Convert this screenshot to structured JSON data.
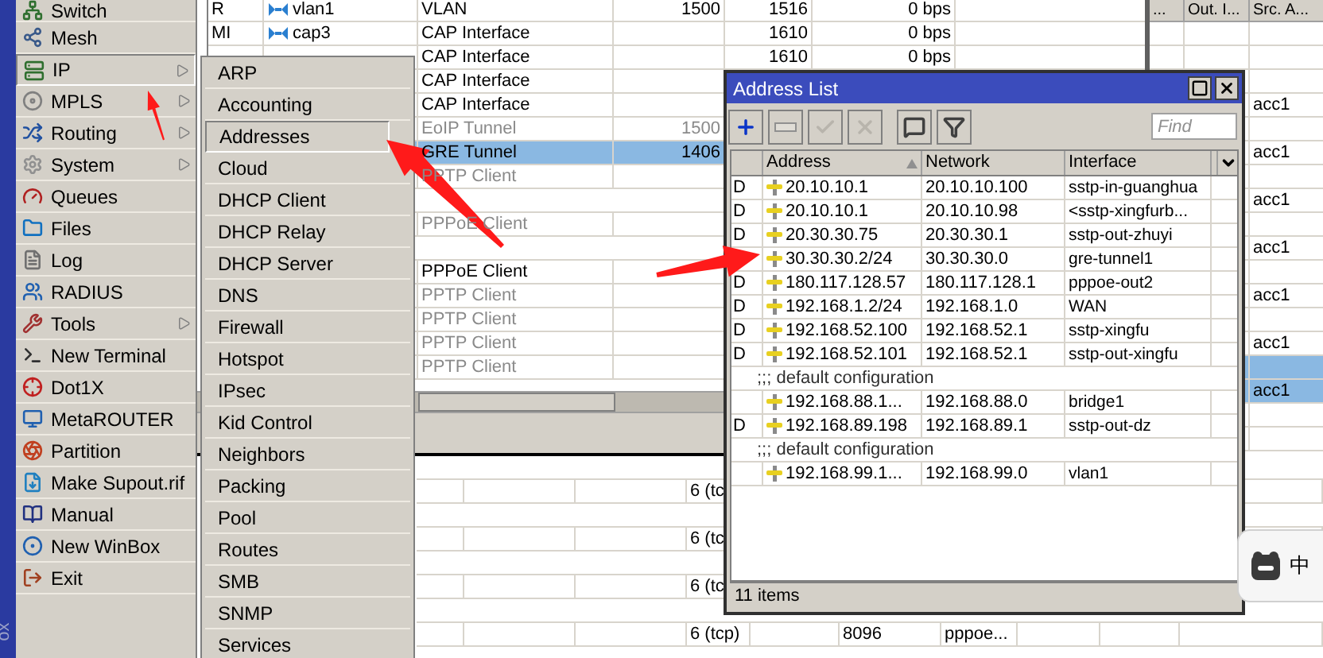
{
  "sidebar_label": "ox",
  "main_menu": [
    {
      "label": "Switch",
      "selected": false,
      "submenu": false
    },
    {
      "label": "Mesh",
      "selected": false,
      "submenu": false
    },
    {
      "label": "IP",
      "selected": true,
      "submenu": true
    },
    {
      "label": "MPLS",
      "selected": false,
      "submenu": true
    },
    {
      "label": "Routing",
      "selected": false,
      "submenu": true
    },
    {
      "label": "System",
      "selected": false,
      "submenu": true
    },
    {
      "label": "Queues",
      "selected": false,
      "submenu": false
    },
    {
      "label": "Files",
      "selected": false,
      "submenu": false
    },
    {
      "label": "Log",
      "selected": false,
      "submenu": false
    },
    {
      "label": "RADIUS",
      "selected": false,
      "submenu": false
    },
    {
      "label": "Tools",
      "selected": false,
      "submenu": true
    },
    {
      "label": "New Terminal",
      "selected": false,
      "submenu": false
    },
    {
      "label": "Dot1X",
      "selected": false,
      "submenu": false
    },
    {
      "label": "MetaROUTER",
      "selected": false,
      "submenu": false
    },
    {
      "label": "Partition",
      "selected": false,
      "submenu": false
    },
    {
      "label": "Make Supout.rif",
      "selected": false,
      "submenu": false
    },
    {
      "label": "Manual",
      "selected": false,
      "submenu": false
    },
    {
      "label": "New WinBox",
      "selected": false,
      "submenu": false
    },
    {
      "label": "Exit",
      "selected": false,
      "submenu": false
    }
  ],
  "ip_submenu": [
    {
      "label": "ARP",
      "selected": false
    },
    {
      "label": "Accounting",
      "selected": false
    },
    {
      "label": "Addresses",
      "selected": true
    },
    {
      "label": "Cloud",
      "selected": false
    },
    {
      "label": "DHCP Client",
      "selected": false
    },
    {
      "label": "DHCP Relay",
      "selected": false
    },
    {
      "label": "DHCP Server",
      "selected": false
    },
    {
      "label": "DNS",
      "selected": false
    },
    {
      "label": "Firewall",
      "selected": false
    },
    {
      "label": "Hotspot",
      "selected": false
    },
    {
      "label": "IPsec",
      "selected": false
    },
    {
      "label": "Kid Control",
      "selected": false
    },
    {
      "label": "Neighbors",
      "selected": false
    },
    {
      "label": "Packing",
      "selected": false
    },
    {
      "label": "Pool",
      "selected": false
    },
    {
      "label": "Routes",
      "selected": false
    },
    {
      "label": "SMB",
      "selected": false
    },
    {
      "label": "SNMP",
      "selected": false
    },
    {
      "label": "Services",
      "selected": false
    }
  ],
  "interface_table": {
    "rows": [
      {
        "kind": "interface",
        "flags": "R",
        "name": "vlan1",
        "type": "VLAN",
        "actual_mtu": "1500",
        "l2_mtu": "1516",
        "tx": "0 bps",
        "selected": false,
        "disabled": false
      },
      {
        "kind": "interface",
        "flags": "MI",
        "name": "cap3",
        "type": "CAP Interface",
        "l2_mtu": "1610",
        "tx": "0 bps",
        "selected": false,
        "disabled": false
      },
      {
        "kind": "interface",
        "type": "CAP Interface",
        "l2_mtu": "1610",
        "tx": "0 bps",
        "selected": false,
        "disabled": false
      },
      {
        "kind": "interface",
        "type": "CAP Interface",
        "selected": false,
        "disabled": false
      },
      {
        "kind": "interface",
        "type": "CAP Interface",
        "selected": false,
        "disabled": false
      },
      {
        "kind": "interface",
        "type": "EoIP Tunnel",
        "actual_mtu": "1500",
        "selected": false,
        "disabled": true
      },
      {
        "kind": "interface",
        "type": "GRE Tunnel",
        "actual_mtu": "1406",
        "selected": true,
        "disabled": false
      },
      {
        "kind": "interface",
        "type": "PPTP Client",
        "selected": false,
        "disabled": true
      },
      {
        "kind": "blank"
      },
      {
        "kind": "interface",
        "type": "PPPoE Client",
        "selected": false,
        "disabled": true
      },
      {
        "kind": "blank"
      },
      {
        "kind": "interface",
        "type": "PPPoE Client",
        "selected": false,
        "disabled": false
      },
      {
        "kind": "interface",
        "type": "PPTP Client",
        "selected": false,
        "disabled": true
      },
      {
        "kind": "interface",
        "type": "PPTP Client",
        "selected": false,
        "disabled": true
      },
      {
        "kind": "interface",
        "type": "PPTP Client",
        "selected": false,
        "disabled": true
      },
      {
        "kind": "interface",
        "type": "PPTP Client",
        "selected": false,
        "disabled": true
      }
    ]
  },
  "side_table": {
    "columns": [
      "...",
      "Out. I...",
      "Src. A..."
    ],
    "rows": [
      {
        "selected": false
      },
      {
        "selected": false
      },
      {
        "selected": false
      },
      {
        "src_address": "acc1",
        "selected": false
      },
      {
        "selected": false
      },
      {
        "src_address": "acc1",
        "selected": false
      },
      {
        "selected": false
      },
      {
        "src_address": "acc1",
        "selected": false
      },
      {
        "selected": false
      },
      {
        "src_address": "acc1",
        "selected": false
      },
      {
        "selected": false
      },
      {
        "src_address": "acc1",
        "selected": false
      },
      {
        "selected": false
      },
      {
        "src_address": "acc1",
        "selected": false
      },
      {
        "selected": true
      },
      {
        "src_address": "acc1",
        "selected": true
      },
      {
        "selected": false
      },
      {
        "selected": false
      }
    ]
  },
  "lower_table": {
    "rows": [
      {
        "kind": "comment"
      },
      {
        "kind": "data",
        "protocol": "6 (tc"
      },
      {
        "kind": "comment"
      },
      {
        "kind": "data",
        "protocol": "6 (tc"
      },
      {
        "kind": "comment"
      },
      {
        "kind": "data",
        "protocol": "6 (tc"
      },
      {
        "kind": "comment"
      },
      {
        "kind": "data",
        "protocol": "6 (tcp)",
        "port": "8096",
        "interface": "pppoe..."
      },
      {
        "kind": "comment"
      }
    ]
  },
  "address_list": {
    "title": "Address List",
    "toolbar": [
      {
        "kind": "add",
        "disabled": false
      },
      {
        "kind": "remove",
        "disabled": false
      },
      {
        "kind": "enable",
        "disabled": true
      },
      {
        "kind": "disable",
        "disabled": true
      },
      {
        "kind": "comment",
        "disabled": false
      },
      {
        "kind": "filter",
        "disabled": false
      }
    ],
    "search": {
      "placeholder": "Find"
    },
    "columns": [
      {
        "label": "Address",
        "sorted": true
      },
      {
        "label": "Network",
        "sorted": false
      },
      {
        "label": "Interface",
        "sorted": false
      }
    ],
    "rows": [
      {
        "kind": "address",
        "flag": "D",
        "address": "20.10.10.1",
        "network": "20.10.10.100",
        "interface": "sstp-in-guanghua"
      },
      {
        "kind": "address",
        "flag": "D",
        "address": "20.10.10.1",
        "network": "20.10.10.98",
        "interface": "<sstp-xingfurb..."
      },
      {
        "kind": "address",
        "flag": "D",
        "address": "20.30.30.75",
        "network": "20.30.30.1",
        "interface": "sstp-out-zhuyi"
      },
      {
        "kind": "address",
        "address": "30.30.30.2/24",
        "network": "30.30.30.0",
        "interface": "gre-tunnel1"
      },
      {
        "kind": "address",
        "flag": "D",
        "address": "180.117.128.57",
        "network": "180.117.128.1",
        "interface": "pppoe-out2"
      },
      {
        "kind": "address",
        "flag": "D",
        "address": "192.168.1.2/24",
        "network": "192.168.1.0",
        "interface": "WAN"
      },
      {
        "kind": "address",
        "flag": "D",
        "address": "192.168.52.100",
        "network": "192.168.52.1",
        "interface": "sstp-xingfu"
      },
      {
        "kind": "address",
        "flag": "D",
        "address": "192.168.52.101",
        "network": "192.168.52.1",
        "interface": "sstp-out-xingfu"
      },
      {
        "kind": "comment",
        "text": ";;; default configuration"
      },
      {
        "kind": "address",
        "address": "192.168.88.1...",
        "network": "192.168.88.0",
        "interface": "bridge1"
      },
      {
        "kind": "address",
        "flag": "D",
        "address": "192.168.89.198",
        "network": "192.168.89.1",
        "interface": "sstp-out-dz"
      },
      {
        "kind": "comment",
        "text": ";;; default configuration"
      },
      {
        "kind": "address",
        "address": "192.168.99.1...",
        "network": "192.168.99.0",
        "interface": "vlan1"
      }
    ],
    "status": "11 items"
  },
  "ime": {
    "label": "中"
  }
}
